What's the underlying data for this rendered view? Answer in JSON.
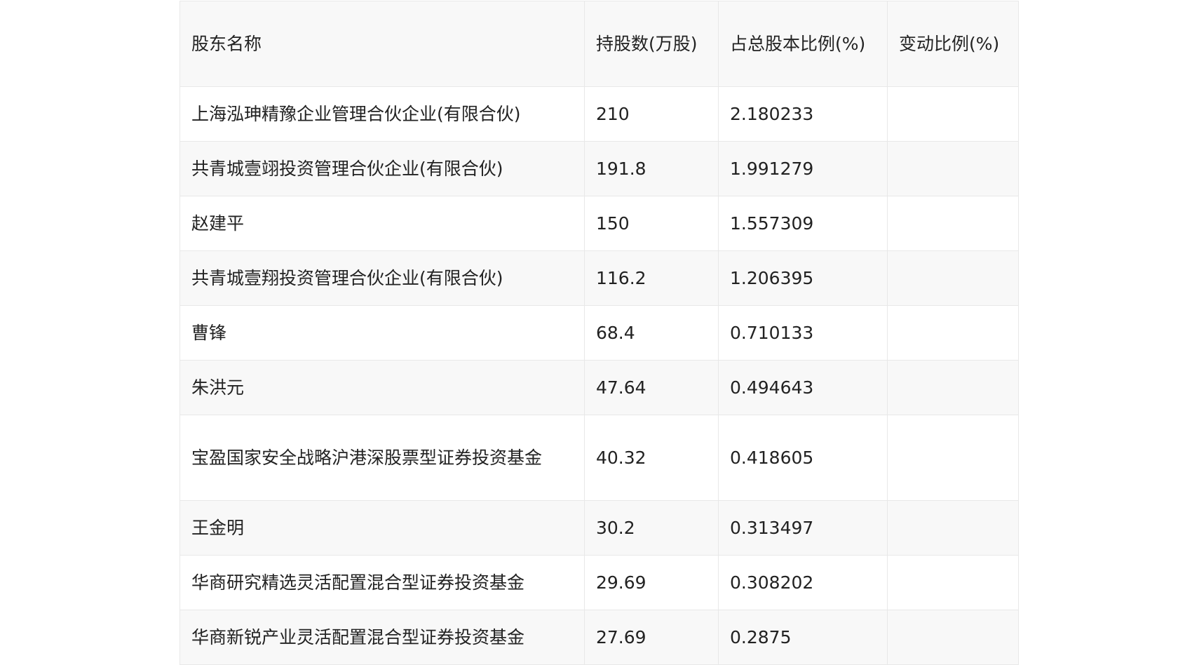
{
  "table": {
    "headers": [
      "股东名称",
      "持股数(万股)",
      "占总股本比例(%)",
      "变动比例(%)"
    ],
    "rows": [
      {
        "name": "上海泓珅精豫企业管理合伙企业(有限合伙)",
        "shares": "210",
        "ratio": "2.180233",
        "change": ""
      },
      {
        "name": "共青城壹翊投资管理合伙企业(有限合伙)",
        "shares": "191.8",
        "ratio": "1.991279",
        "change": ""
      },
      {
        "name": "赵建平",
        "shares": "150",
        "ratio": "1.557309",
        "change": ""
      },
      {
        "name": "共青城壹翔投资管理合伙企业(有限合伙)",
        "shares": "116.2",
        "ratio": "1.206395",
        "change": ""
      },
      {
        "name": "曹锋",
        "shares": "68.4",
        "ratio": "0.710133",
        "change": ""
      },
      {
        "name": "朱洪元",
        "shares": "47.64",
        "ratio": "0.494643",
        "change": ""
      },
      {
        "name": "宝盈国家安全战略沪港深股票型证券投资基金",
        "shares": "40.32",
        "ratio": "0.418605",
        "change": ""
      },
      {
        "name": "王金明",
        "shares": "30.2",
        "ratio": "0.313497",
        "change": ""
      },
      {
        "name": "华商研究精选灵活配置混合型证券投资基金",
        "shares": "29.69",
        "ratio": "0.308202",
        "change": ""
      },
      {
        "name": "华商新锐产业灵活配置混合型证券投资基金",
        "shares": "27.69",
        "ratio": "0.2875",
        "change": ""
      }
    ]
  }
}
